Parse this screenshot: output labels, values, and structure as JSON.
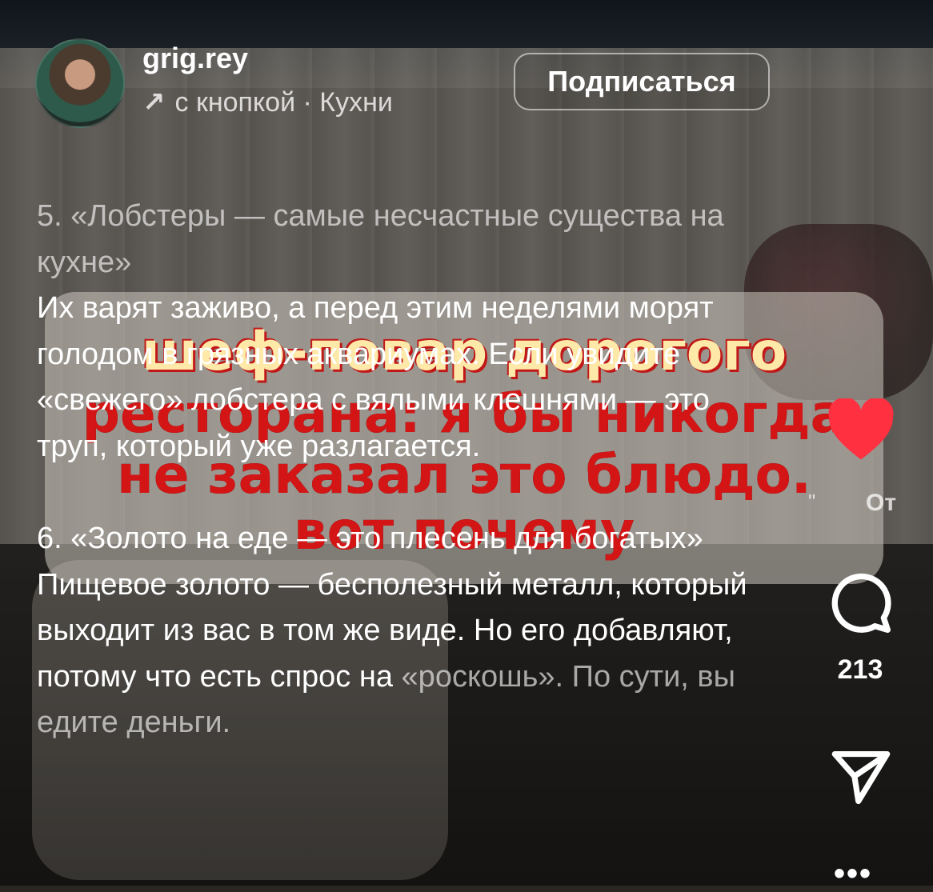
{
  "profile": {
    "username": "grig.rey",
    "subline": "с кнопкой · Кухни",
    "follow_label": "Подписаться"
  },
  "video_caption": {
    "line1": "шеф-повар дорогого",
    "line2": "ресторана: я бы никогда",
    "line3": "не заказал это блюдо.",
    "line4": "вот почему"
  },
  "post": {
    "item5_title": "5. «Лобстеры — самые несчастные существа на кухне»",
    "item5_body": "Их варят заживо, а перед этим неделями морят голодом в грязных аквариумах. Если увидите «свежего» лобстера с вялыми клешнями — это труп, который уже разлагается.",
    "item6_title": "6. «Золото на еде — это плесень для богатых»",
    "item6_body_main": "Пищевое золото — бесполезный металл, который выходит из вас в том же виде. Но его добавляют, потому что есть спрос на",
    "item6_body_end": "«роскошь». По сути, вы едите деньги."
  },
  "rail": {
    "like_color": "#ff3040",
    "side_label": "От",
    "quote_mark": "\"",
    "comment_count": "213",
    "more_label": "•••",
    "icons": [
      "heart-icon",
      "comment-icon",
      "share-icon",
      "more-icon"
    ]
  }
}
